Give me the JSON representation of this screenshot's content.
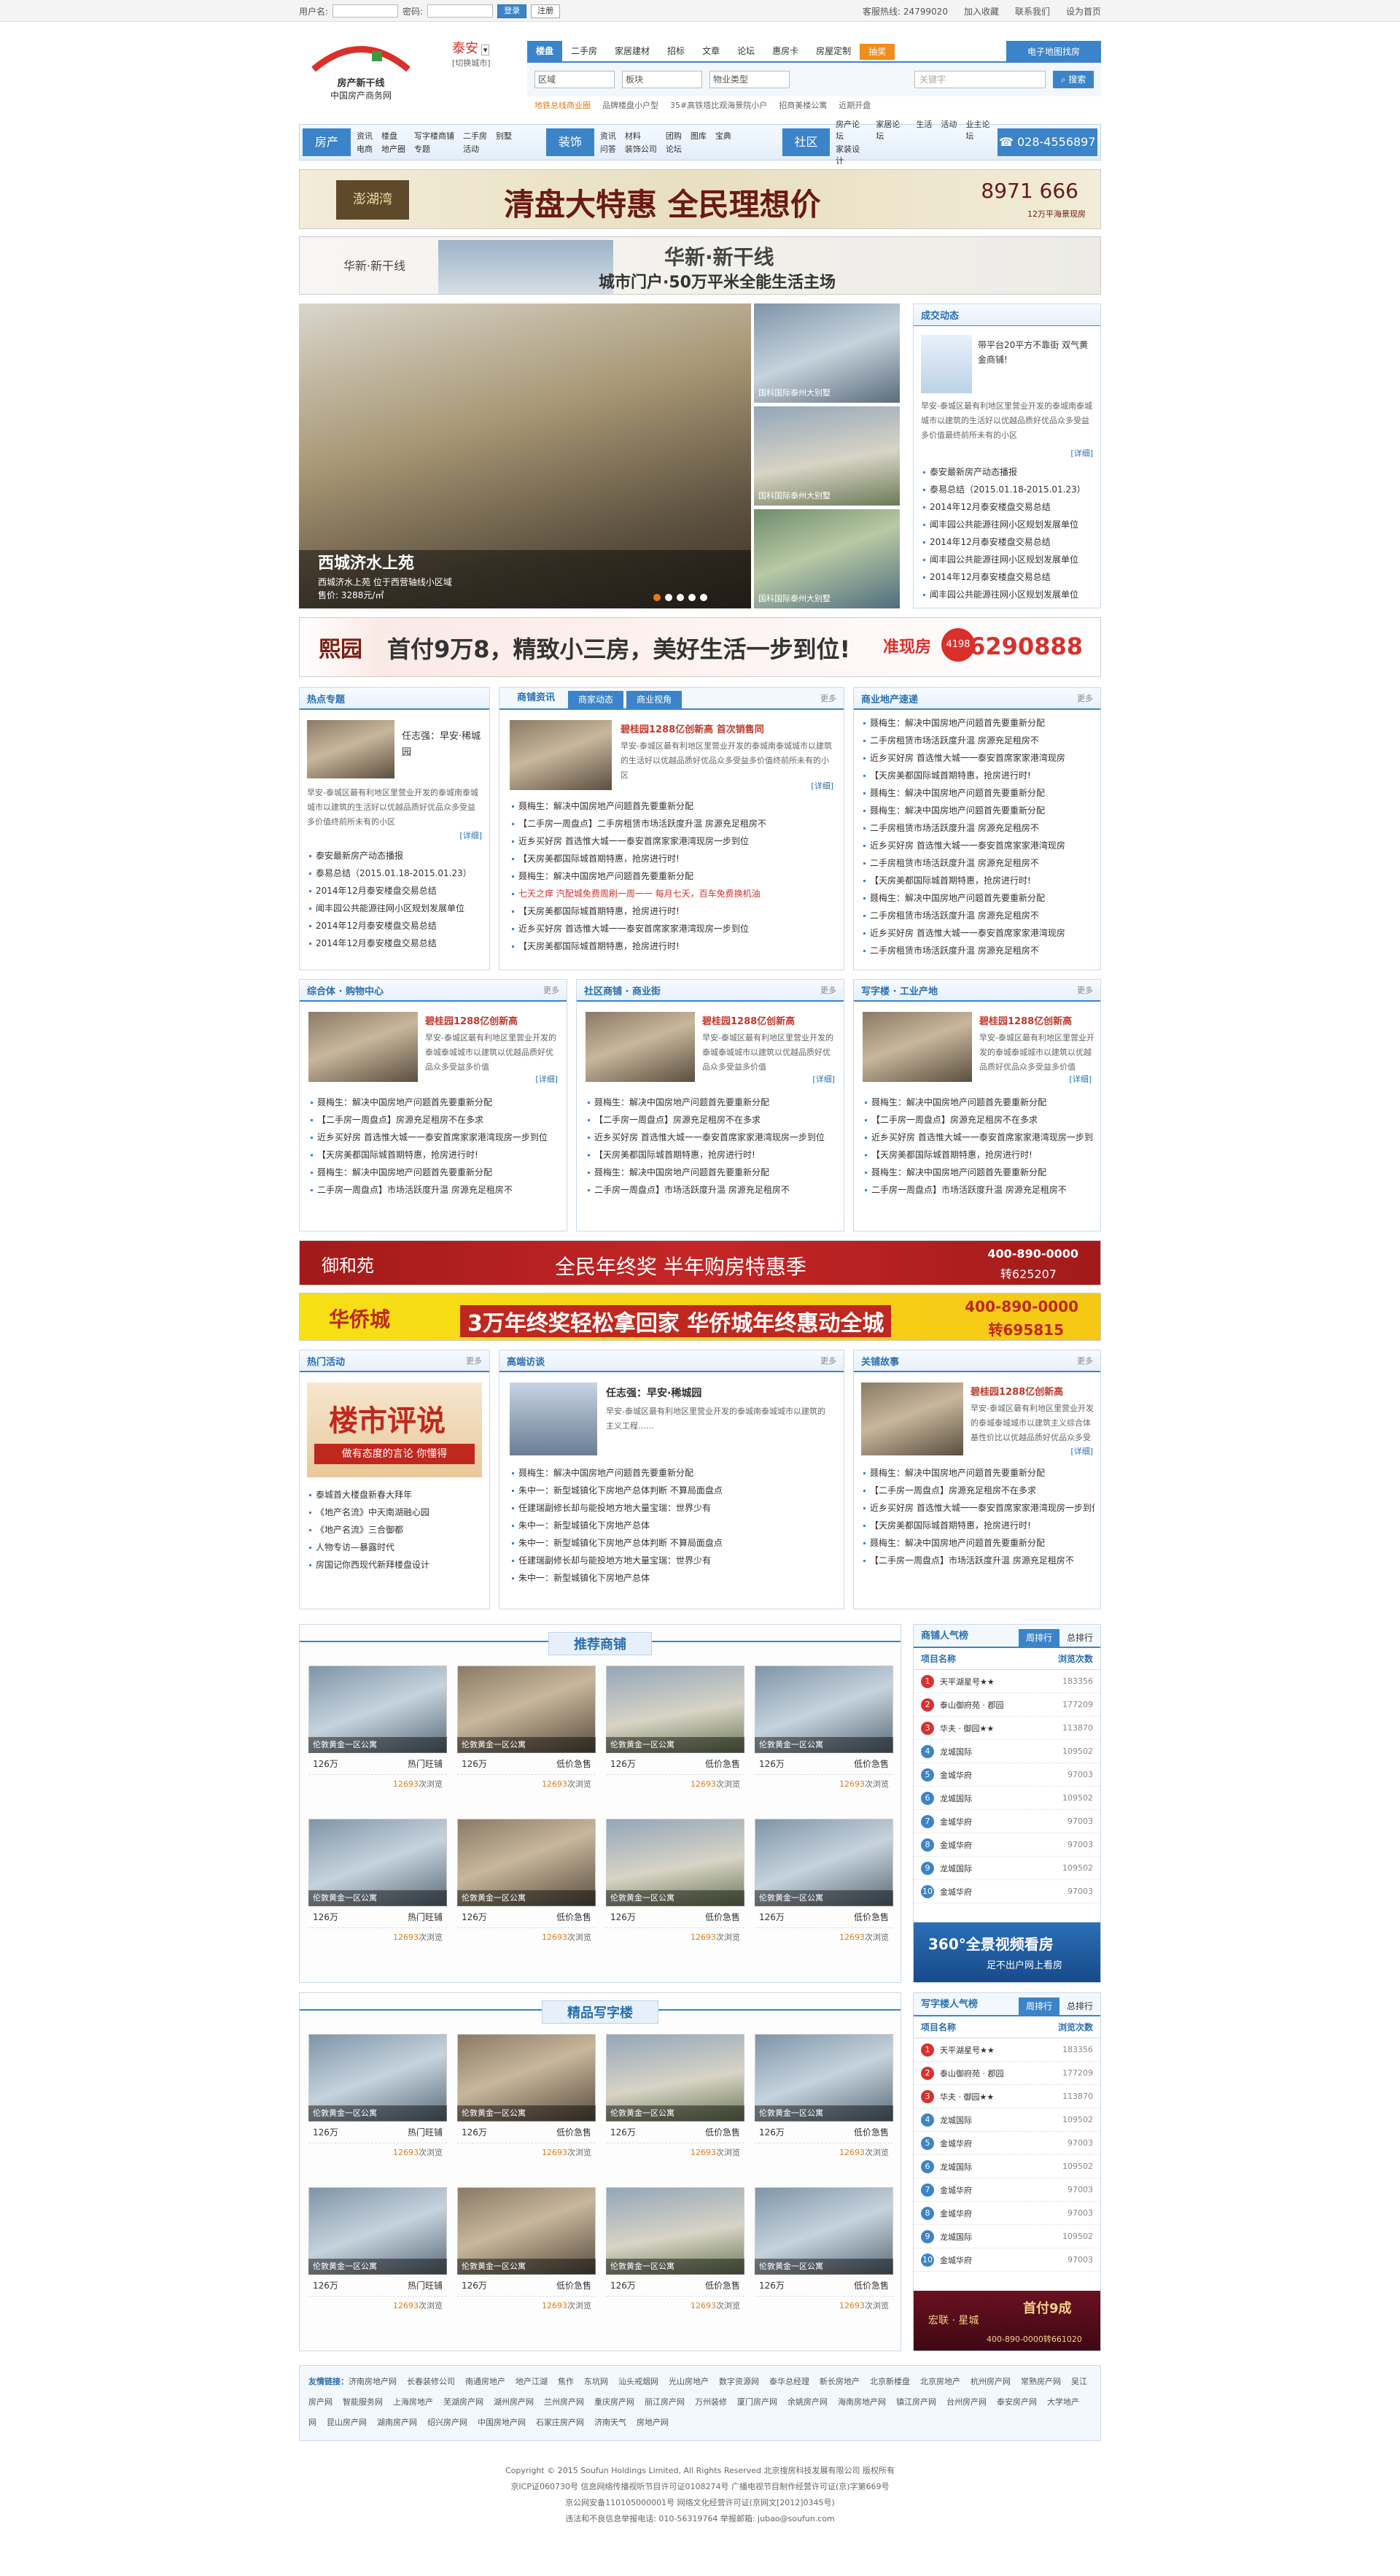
{
  "topbar": {
    "user_label": "用户名:",
    "pass_label": "密码:",
    "login_btn": "登录",
    "register_btn": "注册",
    "service": "客服热线: 24799020",
    "favorite": "加入收藏",
    "contact": "联系我们",
    "homepage": "设为首页"
  },
  "header": {
    "logo_line1": "房产新干线",
    "logo_line2": "中国房产商务网",
    "city": "泰安",
    "city_switch": "[切换城市]",
    "search_tabs": [
      "楼盘",
      "二手房",
      "家居建材",
      "招标",
      "文章",
      "论坛",
      "惠房卡",
      "房屋定制",
      "抽奖"
    ],
    "map_btn": "电子地图找房",
    "selects": [
      "区域",
      "板块",
      "物业类型"
    ],
    "search_placeholder": "关键字",
    "search_btn": "搜索",
    "hot_links": [
      "地铁总线商业圈",
      "品牌楼盘小户型",
      "35#高铁塔比观海景院小户",
      "招商美楼公寓",
      "近期开盘"
    ]
  },
  "nav": {
    "groups": [
      {
        "title": "房产",
        "links": [
          "资讯",
          "楼盘",
          "写字楼商铺",
          "二手房",
          "别墅",
          "电商",
          "地产圈",
          "专题",
          "活动"
        ]
      },
      {
        "title": "装饰",
        "links": [
          "资讯",
          "材料",
          "团购",
          "图库",
          "宝典",
          "问答",
          "装饰公司",
          "论坛"
        ]
      },
      {
        "title": "社区",
        "links": [
          "房产论坛",
          "家居论坛",
          "生活",
          "活动",
          "业主论坛",
          "家装设计"
        ]
      }
    ],
    "phone": "028-4556897"
  },
  "banners": {
    "b1_brand": "澎湖湾",
    "b1_text": "清盘大特惠  全民理想价",
    "b1_tel": "8971 666",
    "b1_sub": "12万平海景现房",
    "b2_brand": "华新·新干线",
    "b2_title": "华新·新干线",
    "b2_text": "城市门户·50万平米全能生活主场",
    "b3_brand": "熙园",
    "b3_text": "首付9万8，精致小三房，美好生活一步到位!",
    "b3_tag": "准现房",
    "b3_price": "4198",
    "b3_phone": "6290888",
    "b4_brand": "御和苑",
    "b4_text": "全民年终奖 半年购房特惠季",
    "b4_phone": "400-890-0000",
    "b4_ext": "转625207",
    "b5_brand": "华侨城",
    "b5_text": "3万年终奖轻松拿回家  华侨城年终惠动全城",
    "b5_phone": "400-890-0000",
    "b5_ext": "转695815"
  },
  "hero": {
    "title": "西城济水上苑",
    "desc": "西城济水上苑  位于西营轴线小区域",
    "price": "售价: 3288元/㎡",
    "side_items": [
      "国科国际泰州大别墅",
      "国科国际泰州大别墅",
      "国科国际泰州大别墅"
    ]
  },
  "deal": {
    "heading": "成交动态",
    "feature_title": "带平台20平方不靠街 双气黄金商铺!",
    "feature_desc": "早安-泰城区最有利地区里营业开发的泰城南泰城城市以建筑的生活好以优越品质好优品众多受益多价值最终前所未有的小区",
    "detail": "[详细]",
    "items": [
      "泰安最新房产动态播报",
      "泰易总结（2015.01.18-2015.01.23）",
      "2014年12月泰安楼盘交易总结",
      "闻丰园公共能源往网小区规划发展单位",
      "2014年12月泰安楼盘交易总结",
      "闻丰园公共能源往网小区规划发展单位",
      "2014年12月泰安楼盘交易总结",
      "闻丰园公共能源往网小区规划发展单位"
    ]
  },
  "hot_topic": {
    "heading": "热点专题",
    "feature_title": "任志强：早安·稀城园",
    "feature_desc": "早安-泰城区最有利地区里营业开发的泰城南泰城城市以建筑的生活好以优越品质好优品众多受益多价值终前所未有的小区",
    "detail": "[详细]",
    "items": [
      "泰安最新房产动态播报",
      "泰易总结（2015.01.18-2015.01.23）",
      "2014年12月泰安楼盘交易总结",
      "闻丰园公共能源往网小区规划发展单位",
      "2014年12月泰安楼盘交易总结",
      "2014年12月泰安楼盘交易总结"
    ]
  },
  "news_mid": {
    "tabs": [
      "商铺资讯",
      "商家动态",
      "商业视角"
    ],
    "more": "更多",
    "feature_title": "碧桂园1288亿创新高 首次销售同",
    "feature_desc": "早安-泰城区最有利地区里营业开发的泰城南泰城城市以建筑的生活好以优越品质好优品众多受益多价值终前所未有的小区",
    "detail": "[详细]",
    "items": [
      "聂梅生：解决中国房地产问题首先要重新分配",
      "【二手房一周盘点】二手房租赁市场活跃度升温 房源充足租房不",
      "近乡买好房  首选惟大城一一泰安首席家家港湾现房一步到位",
      "【天房美都国际城首期特惠，抢房进行时!",
      "聂梅生：解决中国房地产问题首先要重新分配",
      "七天之痒 汽配城免费周刷一周一一 每月七天，百车免费换机油",
      "【天房美都国际城首期特惠，抢房进行时!",
      "近乡买好房  首选惟大城一一泰安首席家家港湾现房一步到位",
      "【天房美都国际城首期特惠，抢房进行时!"
    ]
  },
  "biz_fast": {
    "heading": "商业地产速递",
    "more": "更多",
    "items": [
      "聂梅生：解决中国房地产问题首先要重新分配",
      "二手房租赁市场活跃度升温 房源充足租房不",
      "近乡买好房 首选惟大城一一泰安首席家家港湾现房",
      "【天房美都国际城首期特惠，抢房进行时!",
      "聂梅生：解决中国房地产问题首先要重新分配",
      "聂梅生：解决中国房地产问题首先要重新分配",
      "二手房租赁市场活跃度升温 房源充足租房不",
      "近乡买好房 首选惟大城一一泰安首席家家港湾现房",
      "二手房租赁市场活跃度升温 房源充足租房不",
      "【天房美都国际城首期特惠，抢房进行时!",
      "聂梅生：解决中国房地产问题首先要重新分配",
      "二手房租赁市场活跃度升温 房源充足租房不",
      "近乡买好房 首选惟大城一一泰安首席家家港湾现房",
      "二手房租赁市场活跃度升温 房源充足租房不"
    ]
  },
  "three_cols": [
    {
      "heading": "综合体 · 购物中心",
      "more": "更多",
      "feature_title": "碧桂园1288亿创新高",
      "feature_desc": "早安-泰城区最有利地区里营业开发的泰城泰城城市以建筑以优越品质好优品众多受益多价值",
      "detail": "[详细]",
      "items": [
        "聂梅生：解决中国房地产问题首先要重新分配",
        "【二手房一周盘点】房源充足租房不在多求",
        "近乡买好房 首选惟大城一一泰安首席家家港湾现房一步到位",
        "【天房美都国际城首期特惠，抢房进行时!",
        "聂梅生：解决中国房地产问题首先要重新分配",
        "二手房一周盘点】市场活跃度升温 房源充足租房不"
      ]
    },
    {
      "heading": "社区商铺 · 商业街",
      "more": "更多",
      "feature_title": "碧桂园1288亿创新高",
      "feature_desc": "早安-泰城区最有利地区里营业开发的泰城泰城城市以建筑以优越品质好优品众多受益多价值",
      "detail": "[详细]",
      "items": [
        "聂梅生：解决中国房地产问题首先要重新分配",
        "【二手房一周盘点】房源充足租房不在多求",
        "近乡买好房 首选惟大城一一泰安首席家家港湾现房一步到位",
        "【天房美都国际城首期特惠，抢房进行时!",
        "聂梅生：解决中国房地产问题首先要重新分配",
        "二手房一周盘点】市场活跃度升温 房源充足租房不"
      ]
    },
    {
      "heading": "写字楼 · 工业产地",
      "more": "更多",
      "feature_title": "碧桂园1288亿创新高",
      "feature_desc": "早安-泰城区最有利地区里营业开发的泰城泰城城市以建筑以优越品质好优品众多受益多价值",
      "detail": "[详细]",
      "items": [
        "聂梅生：解决中国房地产问题首先要重新分配",
        "【二手房一周盘点】房源充足租房不在多求",
        "近乡买好房 首选惟大城一一泰安首席家家港湾现房一步到位",
        "【天房美都国际城首期特惠，抢房进行时!",
        "聂梅生：解决中国房地产问题首先要重新分配",
        "二手房一周盘点】市场活跃度升温 房源充足租房不"
      ]
    }
  ],
  "activity": {
    "heading": "热门活动",
    "more": "更多",
    "poster_title": "楼市评说",
    "poster_sub": "做有态度的言论 你懂得",
    "items": [
      "泰城首大楼盘新春大拜年",
      "《地产名流》中天南湖融心园",
      "《地产名流》三合御都",
      "人物专访—暴露时代",
      "房国记你西现代新拜楼盘设计"
    ]
  },
  "interview": {
    "heading": "高端访谈",
    "more": "更多",
    "feature_title": "任志强：早安·稀城园",
    "feature_desc": "早安-泰城区最有利地区里营业开发的泰城南泰城城市以建筑的主义工程……",
    "items": [
      "聂梅生：解决中国房地产问题首先要重新分配",
      "朱中一：新型城镇化下房地产总体判断  不算局面盘点",
      "任建瑞副修长却与能投地方地大量宝瑞：世界少有",
      "朱中一：新型城镇化下房地产总体",
      "朱中一：新型城镇化下房地产总体判断  不算局面盘点",
      "任建瑞副修长却与能投地方地大量宝瑞：世界少有",
      "朱中一：新型城镇化下房地产总体"
    ]
  },
  "story": {
    "heading": "关铺故事",
    "more": "更多",
    "feature_title": "碧桂园1288亿创新高",
    "feature_desc": "早安-泰城区最有利地区里营业开发的泰城泰城城市以建筑主义综合体基性价比以优越品质好优品众多受益多价值",
    "detail": "[详细]",
    "items": [
      "聂梅生：解决中国房地产问题首先要重新分配",
      "【二手房一周盘点】房源充足租房不在多求",
      "近乡买好房 首选惟大城一一泰安首席家家港湾现房一步到位",
      "【天房美都国际城首期特惠，抢房进行时!",
      "聂梅生：解决中国房地产问题首先要重新分配",
      "【二手房一周盘点】市场活跃度升温 房源充足租房不"
    ]
  },
  "shops": {
    "heading": "推荐商铺",
    "cards": [
      {
        "name": "伦敦黄金一区公寓",
        "price": "126万",
        "status": "热门旺铺",
        "views": "12693"
      },
      {
        "name": "伦敦黄金一区公寓",
        "price": "126万",
        "status": "低价急售",
        "views": "12693"
      },
      {
        "name": "伦敦黄金一区公寓",
        "price": "126万",
        "status": "低价急售",
        "views": "12693"
      },
      {
        "name": "伦敦黄金一区公寓",
        "price": "126万",
        "status": "低价急售",
        "views": "12693"
      },
      {
        "name": "伦敦黄金一区公寓",
        "price": "126万",
        "status": "热门旺铺",
        "views": "12693"
      },
      {
        "name": "伦敦黄金一区公寓",
        "price": "126万",
        "status": "低价急售",
        "views": "12693"
      },
      {
        "name": "伦敦黄金一区公寓",
        "price": "126万",
        "status": "低价急售",
        "views": "12693"
      },
      {
        "name": "伦敦黄金一区公寓",
        "price": "126万",
        "status": "低价急售",
        "views": "12693"
      }
    ],
    "views_suffix": "次浏览"
  },
  "offices": {
    "heading": "精品写字楼",
    "cards": [
      {
        "name": "伦敦黄金一区公寓",
        "price": "126万",
        "status": "热门旺铺",
        "views": "12693"
      },
      {
        "name": "伦敦黄金一区公寓",
        "price": "126万",
        "status": "低价急售",
        "views": "12693"
      },
      {
        "name": "伦敦黄金一区公寓",
        "price": "126万",
        "status": "低价急售",
        "views": "12693"
      },
      {
        "name": "伦敦黄金一区公寓",
        "price": "126万",
        "status": "低价急售",
        "views": "12693"
      },
      {
        "name": "伦敦黄金一区公寓",
        "price": "126万",
        "status": "热门旺铺",
        "views": "12693"
      },
      {
        "name": "伦敦黄金一区公寓",
        "price": "126万",
        "status": "低价急售",
        "views": "12693"
      },
      {
        "name": "伦敦黄金一区公寓",
        "price": "126万",
        "status": "低价急售",
        "views": "12693"
      },
      {
        "name": "伦敦黄金一区公寓",
        "price": "126万",
        "status": "低价急售",
        "views": "12693"
      }
    ]
  },
  "rank1": {
    "tabs": [
      "商铺人气榜",
      "周排行",
      "总排行"
    ],
    "col1": "项目名称",
    "col2": "浏览次数",
    "rows": [
      {
        "name": "天平湖星号★★",
        "views": "183356"
      },
      {
        "name": "泰山御府苑 · 郡园",
        "views": "177209"
      },
      {
        "name": "华夫 · 御园★★",
        "views": "113870"
      },
      {
        "name": "龙城国际",
        "views": "109502"
      },
      {
        "name": "金城华府",
        "views": "97003"
      },
      {
        "name": "龙城国际",
        "views": "109502"
      },
      {
        "name": "金城华府",
        "views": "97003"
      },
      {
        "name": "金城华府",
        "views": "97003"
      },
      {
        "name": "龙城国际",
        "views": "109502"
      },
      {
        "name": "金城华府",
        "views": "97003"
      }
    ],
    "ad_title": "360°全景视频看房",
    "ad_sub": "足不出户网上看房"
  },
  "rank2": {
    "tabs": [
      "写字楼人气榜",
      "周排行",
      "总排行"
    ],
    "col1": "项目名称",
    "col2": "浏览次数",
    "rows": [
      {
        "name": "天平湖星号★★",
        "views": "183356"
      },
      {
        "name": "泰山御府苑 · 郡园",
        "views": "177209"
      },
      {
        "name": "华夫 · 御园★★",
        "views": "113870"
      },
      {
        "name": "龙城国际",
        "views": "109502"
      },
      {
        "name": "金城华府",
        "views": "97003"
      },
      {
        "name": "龙城国际",
        "views": "109502"
      },
      {
        "name": "金城华府",
        "views": "97003"
      },
      {
        "name": "金城华府",
        "views": "97003"
      },
      {
        "name": "龙城国际",
        "views": "109502"
      },
      {
        "name": "金城华府",
        "views": "97003"
      }
    ],
    "ad_brand": "宏联 · 星城",
    "ad_text": "首付9成",
    "ad_phone": "400-890-0000转661020"
  },
  "footer": {
    "links_label": "友情链接：",
    "links": [
      "济南房地产网",
      "长春装修公司",
      "南通房地产",
      "地产江湖",
      "焦作",
      "东坑网",
      "汕头戒烟网",
      "光山房地产",
      "数字资源网",
      "泰华总经理",
      "新长房地产",
      "北京新楼盘",
      "北京房地产",
      "杭州房产网",
      "常熟房产网",
      "吴江房产网",
      "智能服务网",
      "上海房地产",
      "芜湖房产网",
      "湖州房产网",
      "兰州房产网",
      "重庆房产网",
      "丽江房产网",
      "万州装修",
      "厦门房产网",
      "余姚房产网",
      "海南房地产网",
      "镇江房产网",
      "台州房产网",
      "泰安房产网",
      "大学地产网",
      "昆山房产网",
      "湖南房产网",
      "绍兴房产网",
      "中国房地产网",
      "石家庄房产网",
      "济南天气",
      "房地产网"
    ],
    "copyright": "Copyright © 2015 Soufun Holdings Limited, All Rights Reserved 北京搜房科技发展有限公司  版权所有",
    "icp": "京ICP证060730号  信息网络传播视听节目许可证0108274号  广播电视节目制作经营许可证(京)字第669号",
    "beian": "京公网安备110105000001号  网络文化经营许可证(京网文[2012]0345号)",
    "contact": "违法和不良信息举报电话: 010-56319764  举报邮箱: jubao@soufun.com"
  }
}
